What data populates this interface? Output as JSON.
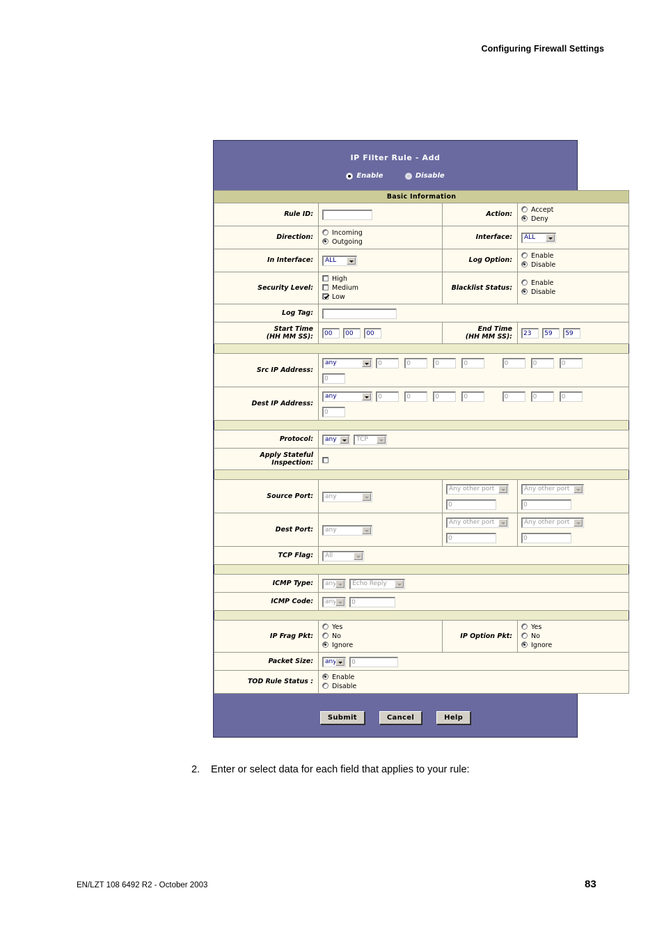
{
  "document": {
    "header_title": "Configuring Firewall Settings",
    "footer_left": "EN/LZT 108 6492 R2 - October 2003",
    "page_number": "83",
    "step_number": "2.",
    "step_text": "Enter or select data for each field that applies to your rule:"
  },
  "screenshot": {
    "title": "IP Filter Rule - Add",
    "rule_state": {
      "enable_label": "Enable",
      "disable_label": "Disable",
      "selected": "Enable"
    },
    "section_header": "Basic Information",
    "labels": {
      "rule_id": "Rule ID:",
      "action": "Action:",
      "direction": "Direction:",
      "interface": "Interface:",
      "in_interface": "In Interface:",
      "log_option": "Log Option:",
      "security_level": "Security Level:",
      "blacklist_status": "Blacklist Status:",
      "log_tag": "Log Tag:",
      "start_time": "Start Time",
      "start_time_fmt": "(HH MM SS):",
      "end_time": "End Time",
      "end_time_fmt": "(HH MM SS):",
      "src_ip": "Src IP Address:",
      "dest_ip": "Dest IP Address:",
      "protocol": "Protocol:",
      "stateful": "Apply Stateful",
      "stateful2": "Inspection:",
      "source_port": "Source Port:",
      "dest_port": "Dest Port:",
      "tcp_flag": "TCP Flag:",
      "icmp_type": "ICMP Type:",
      "icmp_code": "ICMP Code:",
      "ip_frag_pkt": "IP Frag Pkt:",
      "ip_option_pkt": "IP Option Pkt:",
      "packet_size": "Packet Size:",
      "tod_rule_status": "TOD Rule Status :"
    },
    "values": {
      "rule_id": "",
      "action_accept": "Accept",
      "action_deny": "Deny",
      "action_selected": "Deny",
      "direction_incoming": "Incoming",
      "direction_outgoing": "Outgoing",
      "direction_selected": "Outgoing",
      "interface": "ALL",
      "in_interface": "ALL",
      "log_option_enable": "Enable",
      "log_option_disable": "Disable",
      "log_option_selected": "Disable",
      "security_high": "High",
      "security_medium": "Medium",
      "security_low": "Low",
      "security_checked": "Low",
      "blacklist_enable": "Enable",
      "blacklist_disable": "Disable",
      "blacklist_selected": "Disable",
      "log_tag": "",
      "start_hh": "00",
      "start_mm": "00",
      "start_ss": "00",
      "end_hh": "23",
      "end_mm": "59",
      "end_ss": "59",
      "src_ip_mode": "any",
      "src_ip_octets": [
        "0",
        "0",
        "0",
        "0",
        "0",
        "0",
        "0"
      ],
      "src_ip_extra": "0",
      "dest_ip_mode": "any",
      "dest_ip_octets": [
        "0",
        "0",
        "0",
        "0",
        "0",
        "0",
        "0"
      ],
      "dest_ip_extra": "0",
      "protocol_mode": "any",
      "protocol_name": "TCP",
      "stateful_checked": false,
      "source_port_mode": "any",
      "source_port_from_sel": "Any other port",
      "source_port_from_val": "0",
      "source_port_to_sel": "Any other port",
      "source_port_to_val": "0",
      "dest_port_mode": "any",
      "dest_port_from_sel": "Any other port",
      "dest_port_from_val": "0",
      "dest_port_to_sel": "Any other port",
      "dest_port_to_val": "0",
      "tcp_flag": "All",
      "icmp_type_mode": "any",
      "icmp_type_name": "Echo Reply",
      "icmp_code_mode": "any",
      "icmp_code_val": "0",
      "frag_yes": "Yes",
      "frag_no": "No",
      "frag_ignore": "Ignore",
      "frag_selected": "Ignore",
      "option_yes": "Yes",
      "option_no": "No",
      "option_ignore": "Ignore",
      "option_selected": "Ignore",
      "packet_size_mode": "any",
      "packet_size_val": "0",
      "tod_enable": "Enable",
      "tod_disable": "Disable",
      "tod_selected": "Enable"
    },
    "buttons": {
      "submit": "Submit",
      "cancel": "Cancel",
      "help": "Help"
    },
    "colors": {
      "panel_bg": "#6a6aa0",
      "section_header_bg": "#cccc99",
      "row_bg": "#fffbef",
      "spacer_bg": "#ececca",
      "field_text": "#00007a"
    }
  }
}
